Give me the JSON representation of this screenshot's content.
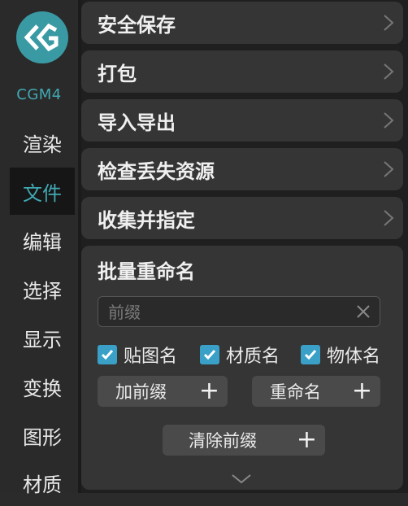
{
  "sidebar": {
    "brand": "CGM4",
    "items": [
      {
        "label": "渲染"
      },
      {
        "label": "文件"
      },
      {
        "label": "编辑"
      },
      {
        "label": "选择"
      },
      {
        "label": "显示"
      },
      {
        "label": "变换"
      },
      {
        "label": "图形"
      },
      {
        "label": "材质"
      }
    ],
    "active_index": 1,
    "accent_color": "#41a9b3"
  },
  "menu": {
    "items": [
      {
        "label": "安全保存"
      },
      {
        "label": "打包"
      },
      {
        "label": "导入导出"
      },
      {
        "label": "检查丢失资源"
      },
      {
        "label": "收集并指定"
      }
    ]
  },
  "batch_rename": {
    "title": "批量重命名",
    "prefix_placeholder": "前缀",
    "prefix_value": "",
    "checkboxes": [
      {
        "label": "贴图名",
        "checked": true
      },
      {
        "label": "材质名",
        "checked": true
      },
      {
        "label": "物体名",
        "checked": true
      }
    ],
    "add_prefix_label": "加前缀",
    "rename_label": "重命名",
    "clear_prefix_label": "清除前缀",
    "plus_glyph": "+"
  }
}
